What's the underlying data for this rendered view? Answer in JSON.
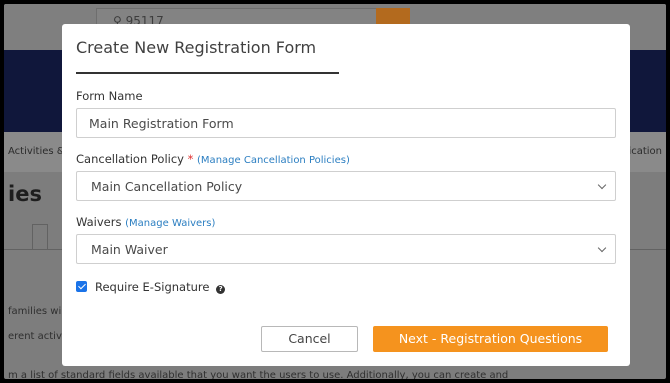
{
  "background": {
    "search_value": "95117",
    "nav_left": "Activities &",
    "nav_right": "ication",
    "heading": "ies",
    "text_lines": [
      "families wi",
      "erent activi",
      "m a list of standard fields available that you want the users to use. Additionally, you can create and"
    ]
  },
  "modal": {
    "title": "Create New Registration Form",
    "form_name": {
      "label": "Form Name",
      "value": "Main Registration Form"
    },
    "cancellation_policy": {
      "label": "Cancellation Policy",
      "required_marker": "*",
      "link": "(Manage Cancellation Policies)",
      "selected": "Main Cancellation Policy"
    },
    "waivers": {
      "label": "Waivers",
      "link": "(Manage Waivers)",
      "selected": "Main Waiver"
    },
    "require_signature": {
      "label": "Require E-Signature",
      "checked": true,
      "help_icon": "question-circle-icon"
    },
    "buttons": {
      "cancel": "Cancel",
      "next": "Next - Registration Questions"
    }
  },
  "colors": {
    "accent": "#f5931e",
    "link": "#2b7ec1",
    "checkbox": "#1a73e8",
    "required": "#e03030",
    "header_band": "#10173b"
  }
}
